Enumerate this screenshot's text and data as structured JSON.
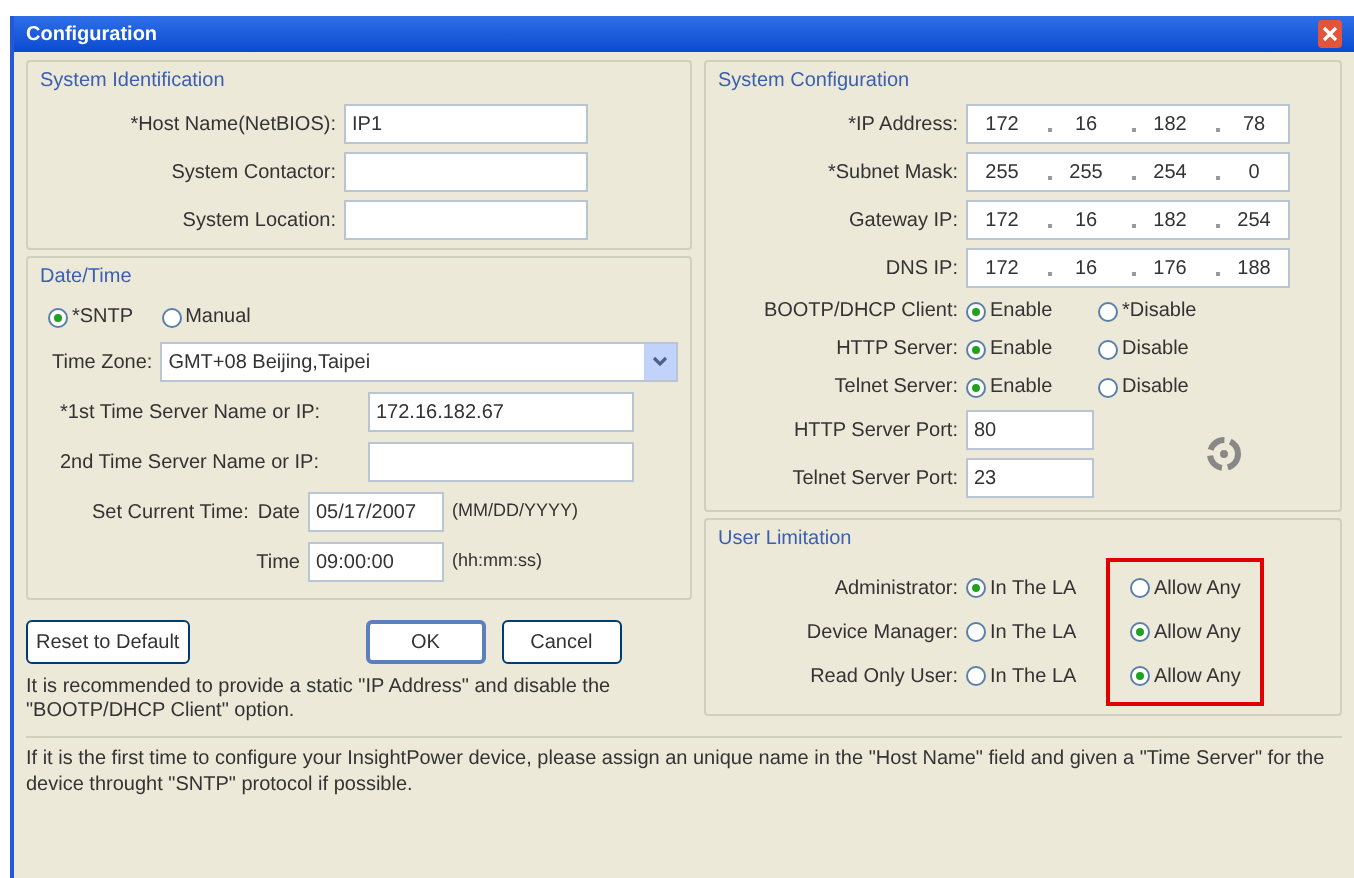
{
  "window": {
    "title": "Configuration"
  },
  "system_identification": {
    "title": "System Identification",
    "fields": [
      {
        "label": "*Host Name(NetBIOS):",
        "value": "IP1"
      },
      {
        "label": "System Contactor:"
      },
      {
        "label": "System Location:"
      }
    ]
  },
  "date_time": {
    "title": "Date/Time",
    "modes": [
      {
        "label": "*SNTP",
        "selected": true
      },
      {
        "label": "Manual",
        "selected": false
      }
    ],
    "time_zone": {
      "label": "Time Zone:",
      "value": "GMT+08 Beijing,Taipei"
    },
    "servers": [
      {
        "label": "*1st Time Server Name or IP:",
        "value": "172.16.182.67"
      },
      {
        "label": "2nd Time Server Name or IP:"
      }
    ],
    "set_time": {
      "label": "Set Current Time:",
      "rows": [
        {
          "label": "Date",
          "value": "05/17/2007",
          "hint": "(MM/DD/YYYY)"
        },
        {
          "label": "Time",
          "value": "09:00:00",
          "hint": "(hh:mm:ss)"
        }
      ]
    }
  },
  "buttons": {
    "reset": "Reset to Default",
    "ok": "OK",
    "cancel": "Cancel"
  },
  "note": "It is recommended to provide a static \"IP Address\" and disable the \"BOOTP/DHCP Client\" option.",
  "system_configuration": {
    "title": "System Configuration",
    "addresses": [
      {
        "label": "*IP Address:",
        "octets": [
          "172",
          "16",
          "182",
          "78"
        ]
      },
      {
        "label": "*Subnet Mask:",
        "octets": [
          "255",
          "255",
          "254",
          "0"
        ]
      },
      {
        "label": "Gateway IP:",
        "octets": [
          "172",
          "16",
          "182",
          "254"
        ]
      },
      {
        "label": "DNS IP:",
        "octets": [
          "172",
          "16",
          "176",
          "188"
        ]
      }
    ],
    "options": [
      {
        "label": "BOOTP/DHCP Client:",
        "choices": [
          {
            "label": "Enable",
            "selected": true
          },
          {
            "label": "*Disable",
            "selected": false
          }
        ]
      },
      {
        "label": "HTTP Server:",
        "choices": [
          {
            "label": "Enable",
            "selected": true
          },
          {
            "label": "Disable",
            "selected": false
          }
        ]
      },
      {
        "label": "Telnet Server:",
        "choices": [
          {
            "label": "Enable",
            "selected": true
          },
          {
            "label": "Disable",
            "selected": false
          }
        ]
      }
    ],
    "ports": [
      {
        "label": "HTTP Server Port:",
        "value": "80"
      },
      {
        "label": "Telnet Server Port:",
        "value": "23"
      }
    ]
  },
  "user_limitation": {
    "title": "User Limitation",
    "rows": [
      {
        "label": "Administrator:",
        "choices": [
          {
            "label": "In The LA",
            "selected": true
          },
          {
            "label": "Allow Any",
            "selected": false
          }
        ]
      },
      {
        "label": "Device Manager:",
        "choices": [
          {
            "label": "In The LA",
            "selected": false
          },
          {
            "label": "Allow Any",
            "selected": true
          }
        ]
      },
      {
        "label": "Read Only User:",
        "choices": [
          {
            "label": "In The LA",
            "selected": false
          },
          {
            "label": "Allow Any",
            "selected": true
          }
        ]
      }
    ]
  },
  "footer": "If it is the first time to configure your InsightPower device, please assign an unique name in the \"Host Name\" field and given a \"Time Server\" for the device throught \"SNTP\" protocol if possible."
}
